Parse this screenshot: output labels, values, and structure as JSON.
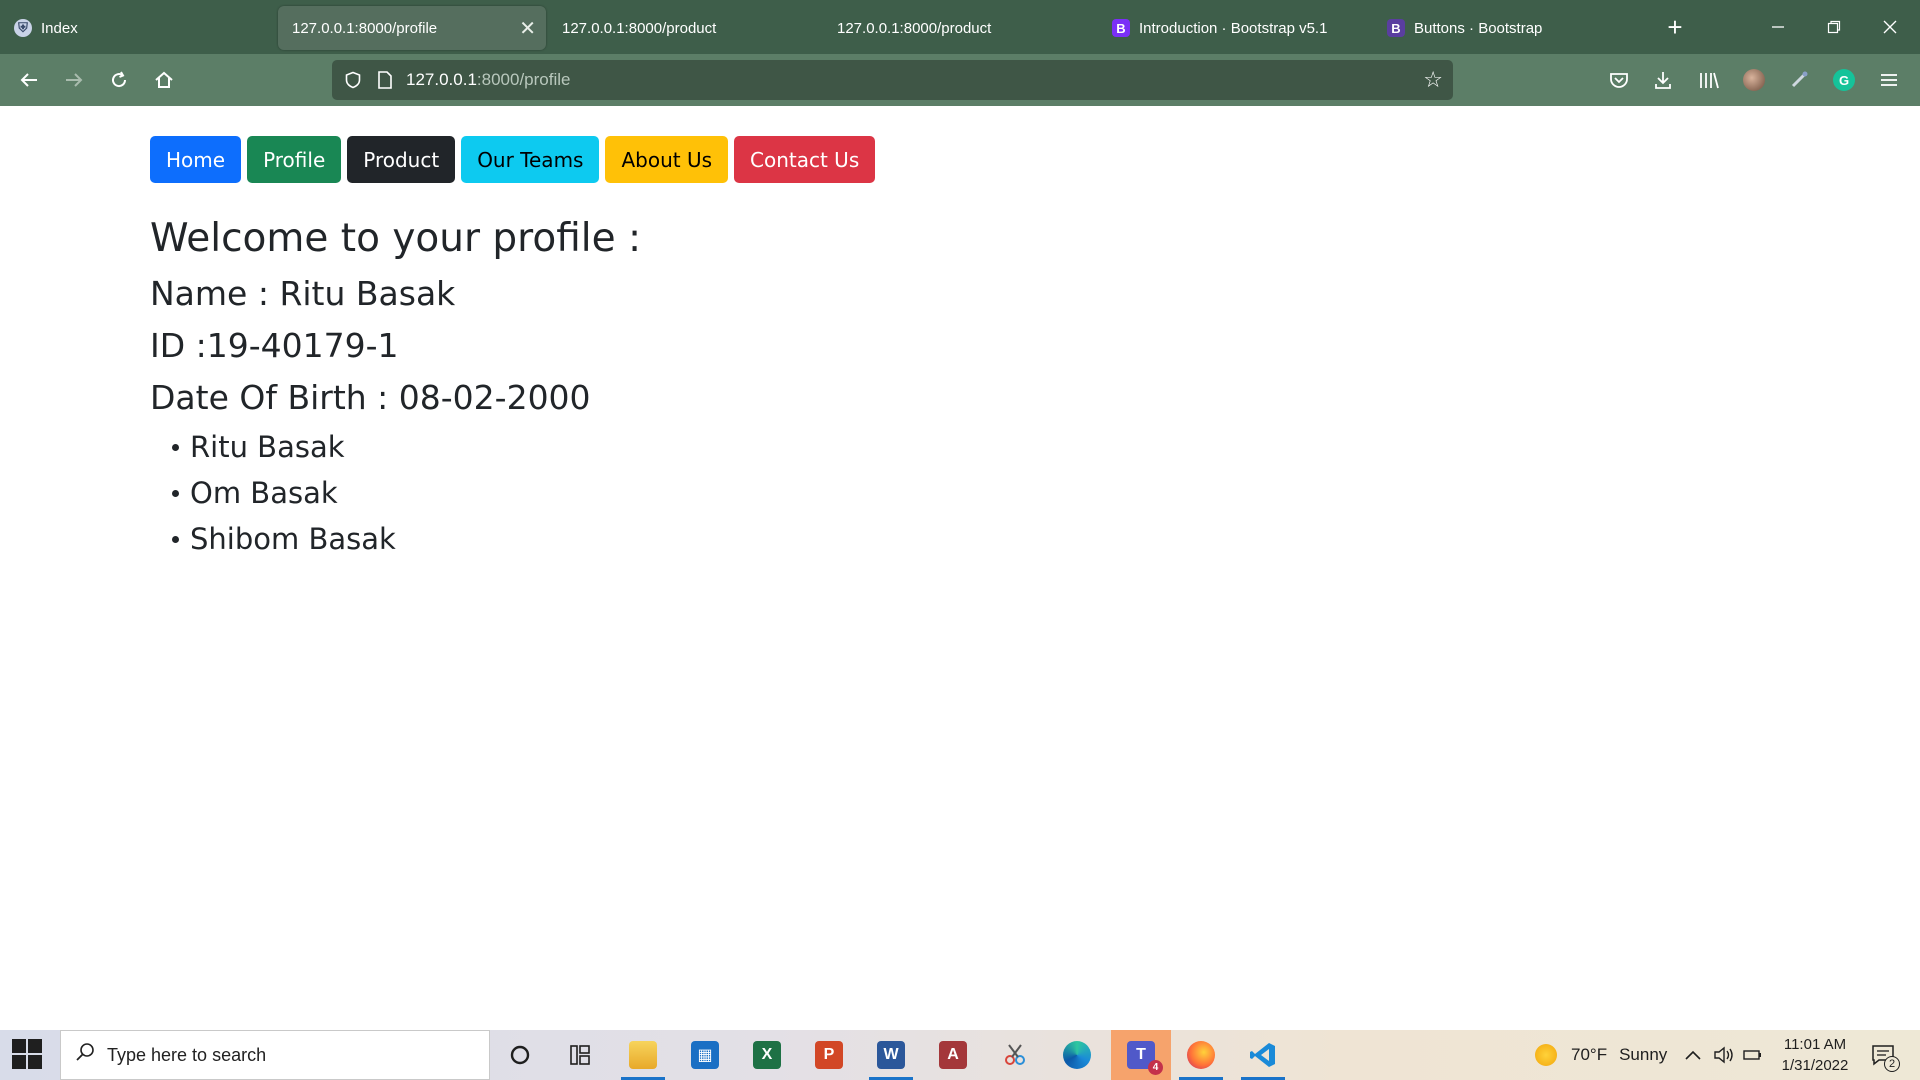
{
  "browser": {
    "tabs": [
      {
        "label": "Index",
        "icon": "shield-favicon"
      },
      {
        "label": "127.0.0.1:8000/profile",
        "active": true
      },
      {
        "label": "127.0.0.1:8000/product"
      },
      {
        "label": "127.0.0.1:8000/product"
      },
      {
        "label": "Introduction · Bootstrap v5.1",
        "icon": "bootstrap-favicon",
        "badge": "B"
      },
      {
        "label": "Buttons · Bootstrap",
        "icon": "bootstrap-favicon",
        "badge": "B"
      }
    ],
    "url_host": "127.0.0.1",
    "url_path": ":8000/profile",
    "close_glyph": "✕",
    "new_tab_glyph": "+"
  },
  "page": {
    "nav_buttons": [
      {
        "label": "Home",
        "color": "#0d6efd"
      },
      {
        "label": "Profile",
        "color": "#198754"
      },
      {
        "label": "Product",
        "color": "#212529"
      },
      {
        "label": "Our Teams",
        "color": "#0dcaf0"
      },
      {
        "label": "About Us",
        "color": "#ffc107"
      },
      {
        "label": "Contact Us",
        "color": "#dc3545"
      }
    ],
    "welcome": "Welcome to your profile :",
    "name": "Name : Ritu Basak",
    "id": "ID :19-40179-1",
    "dob": "Date Of Birth : 08-02-2000",
    "members": [
      "Ritu Basak",
      "Om Basak",
      "Shibom Basak"
    ]
  },
  "taskbar": {
    "search_placeholder": "Type here to search",
    "weather_temp": "70°F",
    "weather_text": "Sunny",
    "time": "11:01 AM",
    "date": "1/31/2022",
    "teams_badge": "4",
    "notification_count": "2",
    "apps": [
      "cortana-icon",
      "task-view-icon",
      "file-explorer-icon",
      "store-icon",
      "excel-icon",
      "powerpoint-icon",
      "word-icon",
      "access-icon",
      "snipping-tool-icon",
      "edge-icon",
      "teams-icon",
      "firefox-icon",
      "vscode-icon"
    ]
  }
}
